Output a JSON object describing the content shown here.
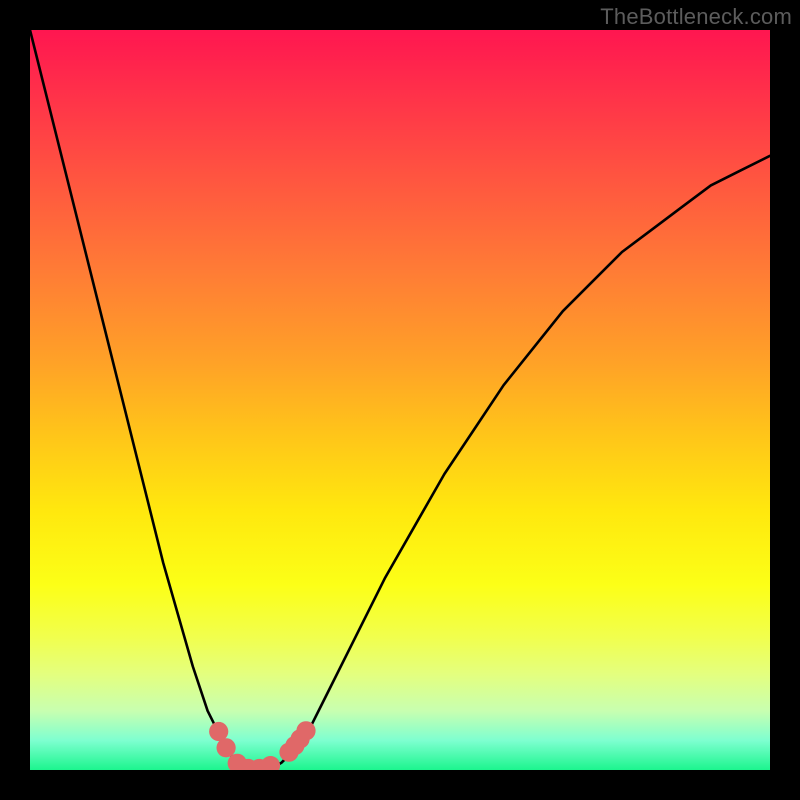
{
  "watermark": {
    "text": "TheBottleneck.com"
  },
  "gradient": {
    "stops": [
      {
        "pct": 0,
        "color": "#ff1650"
      },
      {
        "pct": 8,
        "color": "#ff2f4a"
      },
      {
        "pct": 20,
        "color": "#ff5540"
      },
      {
        "pct": 32,
        "color": "#ff7a36"
      },
      {
        "pct": 45,
        "color": "#ffa227"
      },
      {
        "pct": 55,
        "color": "#ffc619"
      },
      {
        "pct": 65,
        "color": "#ffe80e"
      },
      {
        "pct": 75,
        "color": "#fcff17"
      },
      {
        "pct": 82,
        "color": "#f1ff4d"
      },
      {
        "pct": 87,
        "color": "#e4ff7e"
      },
      {
        "pct": 92,
        "color": "#c8ffb0"
      },
      {
        "pct": 96,
        "color": "#7effd0"
      },
      {
        "pct": 100,
        "color": "#1cf58e"
      }
    ]
  },
  "chart_data": {
    "type": "line",
    "title": "",
    "xlabel": "",
    "ylabel": "",
    "xlim": [
      0,
      100
    ],
    "ylim": [
      0,
      100
    ],
    "x": [
      0,
      2,
      4,
      6,
      8,
      10,
      12,
      14,
      16,
      18,
      20,
      22,
      24,
      26,
      27,
      28,
      29,
      30,
      31,
      32,
      33,
      34,
      36,
      38,
      40,
      44,
      48,
      52,
      56,
      60,
      64,
      68,
      72,
      76,
      80,
      84,
      88,
      92,
      96,
      100
    ],
    "series": [
      {
        "name": "bottleneck-curve",
        "values": [
          100,
          92,
          84,
          76,
          68,
          60,
          52,
          44,
          36,
          28,
          21,
          14,
          8,
          4,
          2.2,
          1.0,
          0.4,
          0.1,
          0.0,
          0.1,
          0.4,
          1.0,
          3,
          6,
          10,
          18,
          26,
          33,
          40,
          46,
          52,
          57,
          62,
          66,
          70,
          73,
          76,
          79,
          81,
          83
        ]
      }
    ],
    "markers": {
      "name": "highlight-dots",
      "color": "#e06868",
      "radius": 1.3,
      "points": [
        {
          "x": 25.5,
          "y": 5.2
        },
        {
          "x": 26.5,
          "y": 3.0
        },
        {
          "x": 28.0,
          "y": 0.9
        },
        {
          "x": 29.5,
          "y": 0.2
        },
        {
          "x": 31.0,
          "y": 0.2
        },
        {
          "x": 32.5,
          "y": 0.6
        },
        {
          "x": 35.0,
          "y": 2.4
        },
        {
          "x": 35.8,
          "y": 3.3
        },
        {
          "x": 36.5,
          "y": 4.2
        },
        {
          "x": 37.3,
          "y": 5.3
        }
      ]
    }
  }
}
